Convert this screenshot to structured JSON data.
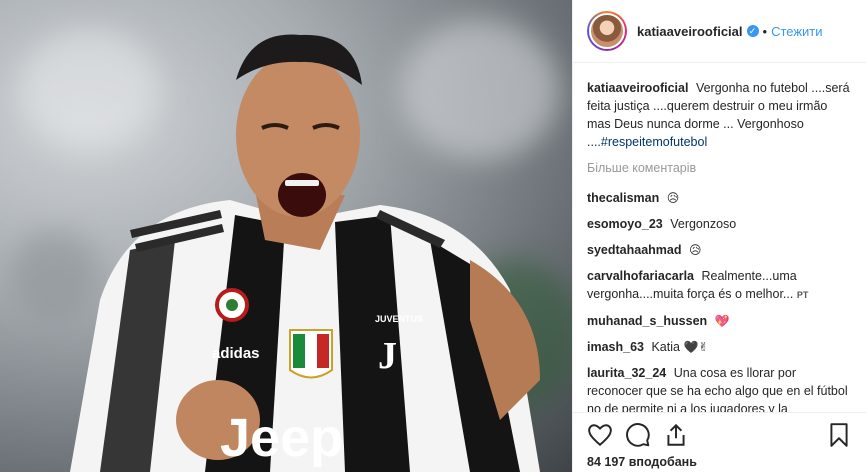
{
  "header": {
    "username": "katiaaveirooficial",
    "separator": "•",
    "follow_label": "Стежити",
    "verified_mark": "✓"
  },
  "caption": {
    "username": "katiaaveirooficial",
    "text": "Vergonha no futebol ....será feita justiça ....querem destruir o meu irmão mas Deus nunca dorme ... Vergonhoso ....",
    "hashtag": "#respeitemofutebol"
  },
  "more_comments_label": "Більше коментарів",
  "comments": [
    {
      "username": "thecalisman",
      "text": "",
      "emoji": "😥"
    },
    {
      "username": "esomoyo_23",
      "text": "Vergonzoso",
      "emoji": ""
    },
    {
      "username": "syedtahaahmad",
      "text": "",
      "emoji": "😥"
    },
    {
      "username": "carvalhofariacarla",
      "text": "Realmente...uma vergonha....muita força és o melhor...",
      "emoji": "",
      "flag": "PT"
    },
    {
      "username": "muhanad_s_hussen",
      "text": "",
      "emoji": "💖"
    },
    {
      "username": "imash_63",
      "text": "Katia",
      "emoji": "🖤✌"
    },
    {
      "username": "laurita_32_24",
      "text": "Una cosa es llorar por reconocer que se ha echo algo que en el fútbol no de permite ni a los jugadores y la consecuencia que con lleva por a verlo",
      "emoji": ""
    }
  ],
  "actions": {
    "icons": [
      "heart-icon",
      "comment-icon",
      "share-icon",
      "bookmark-icon"
    ],
    "likes": "84 197 вподобань"
  },
  "photo": {
    "jersey_text": "Jeep",
    "brand_text": "adidas",
    "club_text": "JUVENTUS"
  },
  "colors": {
    "link": "#3897f0",
    "hashtag": "#003569",
    "muted": "#999999",
    "text": "#262626"
  }
}
